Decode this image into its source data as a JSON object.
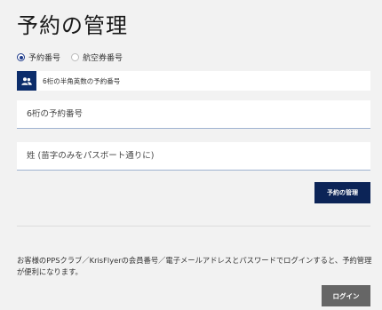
{
  "page": {
    "title": "予約の管理"
  },
  "lookup_type": {
    "options": [
      {
        "label": "予約番号",
        "selected": true
      },
      {
        "label": "航空券番号",
        "selected": false
      }
    ]
  },
  "info_bar": {
    "icon": "users-icon",
    "text": "6桁の半角英数の予約番号"
  },
  "form": {
    "booking_ref_placeholder": "6桁の予約番号",
    "last_name_placeholder": "姓 (苗字のみをパスポート通りに)",
    "submit_label": "予約の管理"
  },
  "login_section": {
    "note": "お客様のPPSクラブ／KrisFlyerの会員番号／電子メールアドレスとパスワードでログインすると、予約管理が便利になります。",
    "login_label": "ログイン"
  },
  "colors": {
    "primary": "#0c2457",
    "accent": "#1e3a8a",
    "secondary_button": "#666666",
    "background": "#f2f2f2"
  }
}
